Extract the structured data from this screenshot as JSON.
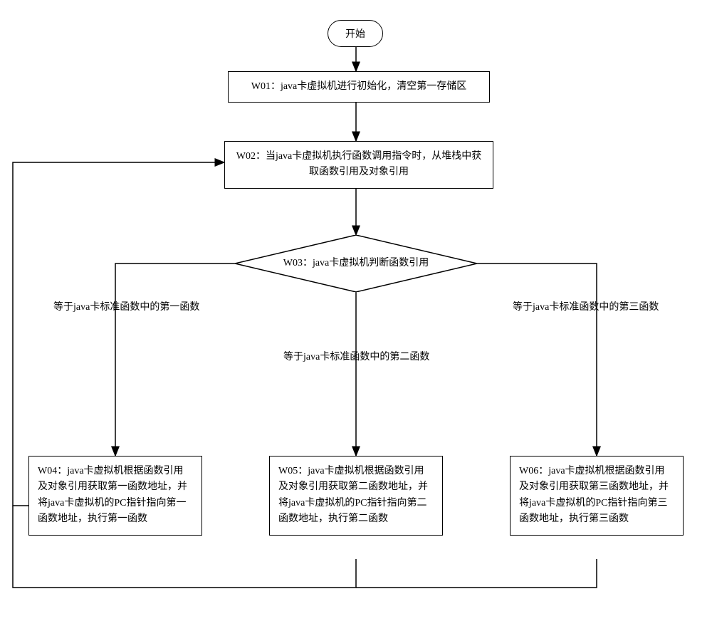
{
  "nodes": {
    "start": "开始",
    "w01": "W01：java卡虚拟机进行初始化，清空第一存储区",
    "w02": "W02：当java卡虚拟机执行函数调用指令时，从堆栈中获取函数引用及对象引用",
    "w03": "W03：java卡虚拟机判断函数引用",
    "w04": "W04：java卡虚拟机根据函数引用及对象引用获取第一函数地址，并将java卡虚拟机的PC指针指向第一函数地址，执行第一函数",
    "w05": "W05：java卡虚拟机根据函数引用及对象引用获取第二函数地址，并将java卡虚拟机的PC指针指向第二函数地址，执行第二函数",
    "w06": "W06：java卡虚拟机根据函数引用及对象引用获取第三函数地址，并将java卡虚拟机的PC指针指向第三函数地址，执行第三函数"
  },
  "edges": {
    "branch1": "等于java卡标准函数中的第一函数",
    "branch2": "等于java卡标准函数中的第二函数",
    "branch3": "等于java卡标准函数中的第三函数"
  }
}
